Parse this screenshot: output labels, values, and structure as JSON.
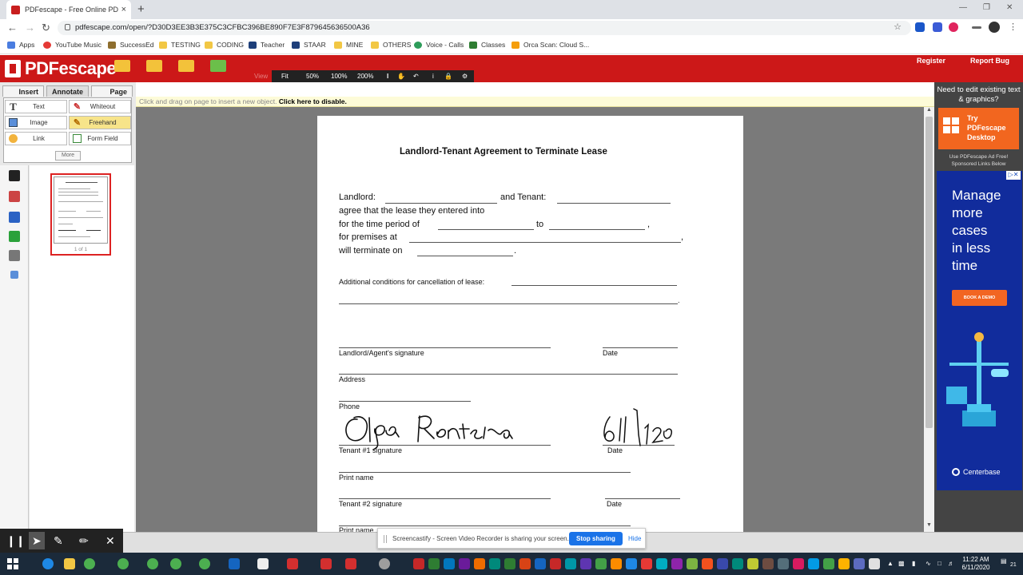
{
  "browser": {
    "tab_title": "PDFescape - Free Online PDF Edi",
    "tab_close": "×",
    "new_tab": "+",
    "url": "pdfescape.com/open/?D30D3EE3B3E375C3CFBC396BE890F7E3F879645636500A36",
    "bookmarks": [
      "Apps",
      "YouTube Music",
      "SuccessEd",
      "TESTING",
      "CODING",
      "Teacher",
      "STAAR",
      "MINE",
      "OTHERS",
      "Voice - Calls",
      "Classes",
      "Orca Scan: Cloud S..."
    ],
    "bookmark_colors": [
      "#4a7de0",
      "#e53935",
      "#8e6e2e",
      "#f2c744",
      "#f2c744",
      "#1e3f7a",
      "#1e3f7a",
      "#f2c744",
      "#f2c744",
      "#2d9c5a",
      "#2e7d32",
      "#f59e0b"
    ]
  },
  "app": {
    "brand": "PDFescape",
    "register": "Register",
    "report_bug": "Report Bug",
    "view_label": "View",
    "zoom": {
      "fit": "Fit",
      "z50": "50%",
      "z100": "100%",
      "z200": "200%"
    },
    "tabs": {
      "insert": "Insert",
      "annotate": "Annotate",
      "page": "Page"
    },
    "tools": {
      "text": "Text",
      "whiteout": "Whiteout",
      "image": "Image",
      "freehand": "Freehand",
      "link": "Link",
      "form_field": "Form Field",
      "more": "More"
    },
    "thumbnail_label": "1 of 1",
    "notice_prefix": "Click and drag on page to insert a new object.",
    "notice_link": "Click here to disable."
  },
  "document": {
    "title": "Landlord-Tenant Agreement to Terminate Lease",
    "line1a": "Landlord:",
    "line1b": "and Tenant:",
    "line2": "agree that the lease they entered into",
    "line3a": "for the time period of",
    "line3b": "to",
    "line3c": ",",
    "line4a": "for premises at",
    "line4b": ",",
    "line5a": "will terminate on",
    "line5b": ".",
    "additional": "Additional conditions for cancellation of lease:",
    "additional_end": ".",
    "landlord_sig": "Landlord/Agent's signature",
    "date": "Date",
    "address": "Address",
    "phone": "Phone",
    "tenant1_sig": "Tenant #1 signature",
    "print_name": "Print name",
    "tenant2_sig": "Tenant #2 signature"
  },
  "ad": {
    "need_edit": "Need to edit existing text & graphics?",
    "try_line1": "Try",
    "try_line2": "PDFescape",
    "try_line3": "Desktop",
    "use_ad": "Use PDFescape Ad Free!",
    "sponsored": "Sponsored Links Below",
    "headline_1": "Manage",
    "headline_2": "more",
    "headline_3": "cases",
    "headline_4": "in less",
    "headline_5": "time",
    "cta": "BOOK A DEMO",
    "brand": "Centerbase"
  },
  "share": {
    "message": "Screencastify - Screen Video Recorder is sharing your screen.",
    "stop": "Stop sharing",
    "hide": "Hide"
  },
  "taskbar": {
    "time": "11:22 AM",
    "date": "6/11/2020",
    "notif_count": "21"
  }
}
